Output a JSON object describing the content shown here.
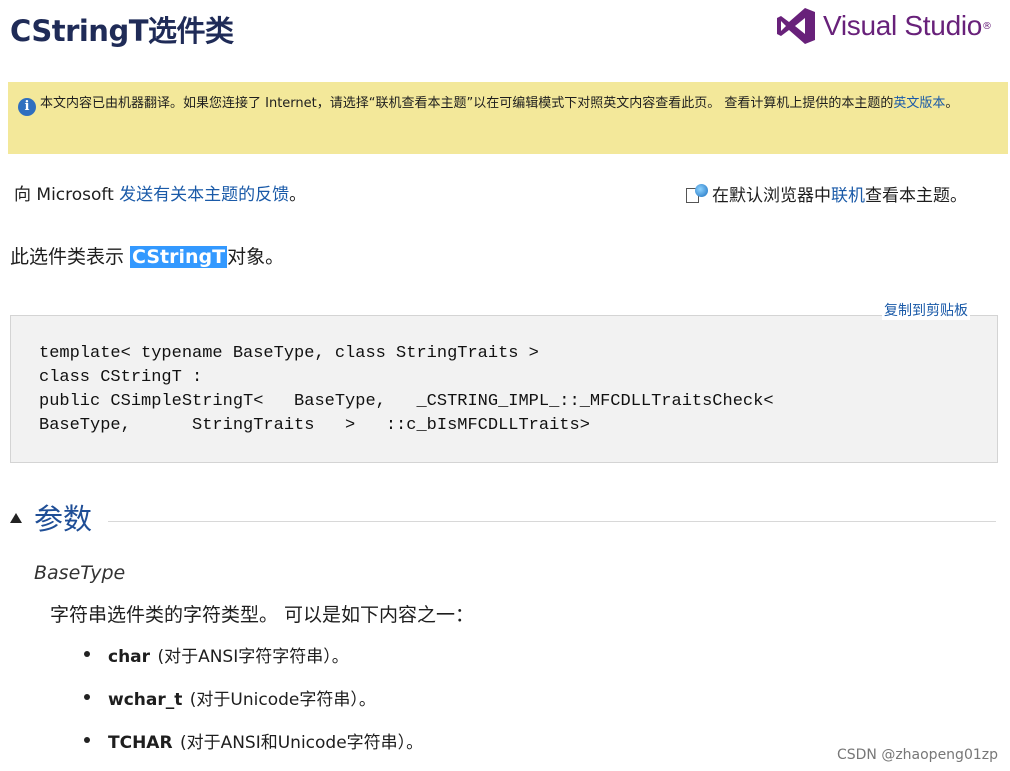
{
  "header": {
    "title": "CStringT选件类",
    "brand": "Visual Studio",
    "brand_color": "#68217a"
  },
  "notice": {
    "icon": "info-icon",
    "text_before_link": "本文内容已由机器翻译。如果您连接了 Internet，请选择“联机查看本主题”以在可编辑模式下对照英文内容查看此页。 查看计算机上提供的本主题的",
    "link": "英文版本",
    "text_after_link": "。",
    "background": "#f3e89a"
  },
  "feedback": {
    "prefix": "向 Microsoft ",
    "link": "发送有关本主题的反馈",
    "suffix": "。"
  },
  "online_view": {
    "icon": "online-view-icon",
    "prefix": "在默认浏览器中",
    "link": "联机",
    "suffix": "查看本主题。"
  },
  "description": {
    "prefix": "此选件类表示 ",
    "highlight": "CStringT",
    "suffix": "对象。"
  },
  "code": {
    "copy_label": "复制到剪贴板",
    "text": "template< typename BaseType, class StringTraits >\nclass CStringT :\npublic CSimpleStringT<   BaseType,   _CSTRING_IMPL_::_MFCDLLTraitsCheck<\nBaseType,      StringTraits   >   ::c_bIsMFCDLLTraits>"
  },
  "section": {
    "title": "参数"
  },
  "param": {
    "name": "BaseType",
    "description": "字符串选件类的字符类型。 可以是如下内容之一：",
    "items": [
      {
        "term": "char",
        "text": " (对于ANSI字符字符串）。"
      },
      {
        "term": "wchar_t",
        "text": " (对于Unicode字符串）。"
      },
      {
        "term": "TCHAR",
        "text": " (对于ANSI和Unicode字符串）。"
      }
    ]
  },
  "watermark": "CSDN @zhaopeng01zp",
  "colors": {
    "link": "#1a5aa8",
    "title": "#1f2b57",
    "section_title": "#1f4e96",
    "highlight": "#3399ff"
  }
}
